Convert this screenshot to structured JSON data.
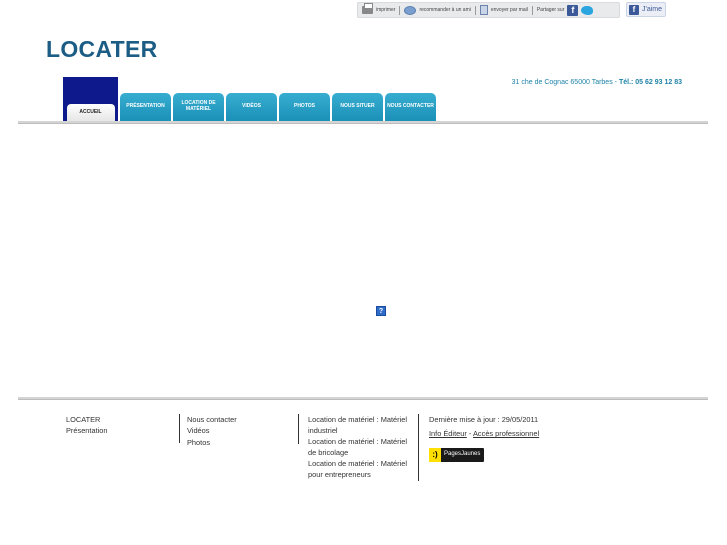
{
  "topbar": {
    "print": "imprimer",
    "recommend": "recommander à un ami",
    "send": "envoyer par mail",
    "share": "Partager sur",
    "like": "J'aime"
  },
  "header": {
    "logo": "LOCATER",
    "address": "31 che de Cognac 65000 Tarbes",
    "dash": "-",
    "tel": "Tél.: 05 62 93 12 83"
  },
  "nav": {
    "tabs": [
      {
        "label": "ACCUEIL"
      },
      {
        "label": "PRÉSENTATION"
      },
      {
        "label": "LOCATION DE MATÉRIEL"
      },
      {
        "label": "VIDÉOS"
      },
      {
        "label": "PHOTOS"
      },
      {
        "label": "NOUS SITUER"
      },
      {
        "label": "NOUS CONTACTER"
      }
    ]
  },
  "content": {
    "placeholder": "?"
  },
  "footer": {
    "col1": [
      "LOCATER",
      "Présentation"
    ],
    "col2": [
      "Nous contacter",
      "Vidéos",
      "Photos"
    ],
    "col3": [
      "Location de matériel : Matériel industriel",
      "Location de matériel : Matériel de bricolage",
      "Location de matériel : Matériel pour entrepreneurs"
    ],
    "update": "Dernière mise à jour : 29/05/2011",
    "info_editeur": "Info Éditeur",
    "separator": "-",
    "acces_pro": "Accès professionnel",
    "pagesjaunes": "PagesJaunes",
    "pj_logo_char": ":)"
  }
}
